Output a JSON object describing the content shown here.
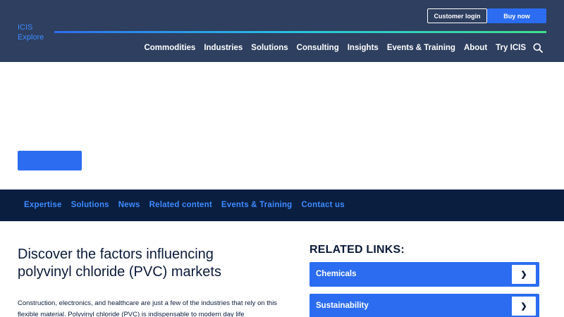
{
  "header": {
    "logo_line1": "ICIS",
    "logo_line2": "Explore",
    "customer_login": "Customer login",
    "buy_now": "Buy now",
    "nav": [
      "Commodities",
      "Industries",
      "Solutions",
      "Consulting",
      "Insights",
      "Events & Training",
      "About",
      "Try ICIS"
    ],
    "search_icon": "search-icon"
  },
  "subnav": [
    "Expertise",
    "Solutions",
    "News",
    "Related content",
    "Events & Training",
    "Contact us"
  ],
  "main": {
    "title": "Discover the factors influencing polyvinyl chloride (PVC) markets",
    "text": "Construction, electronics, and healthcare are just a few of the industries that rely on this flexible material. Polyvinyl chloride (PVC) is indispensable to modern day life"
  },
  "related": {
    "title": "RELATED LINKS:",
    "links": [
      {
        "label": "Chemicals",
        "chevron": "❯"
      },
      {
        "label": "Sustainability",
        "chevron": "❯"
      }
    ]
  },
  "colors": {
    "header_bg": "#2e3f5f",
    "subnav_bg": "#0a1e40",
    "accent_blue": "#2b6cf0",
    "link_blue": "#3d8bff"
  }
}
